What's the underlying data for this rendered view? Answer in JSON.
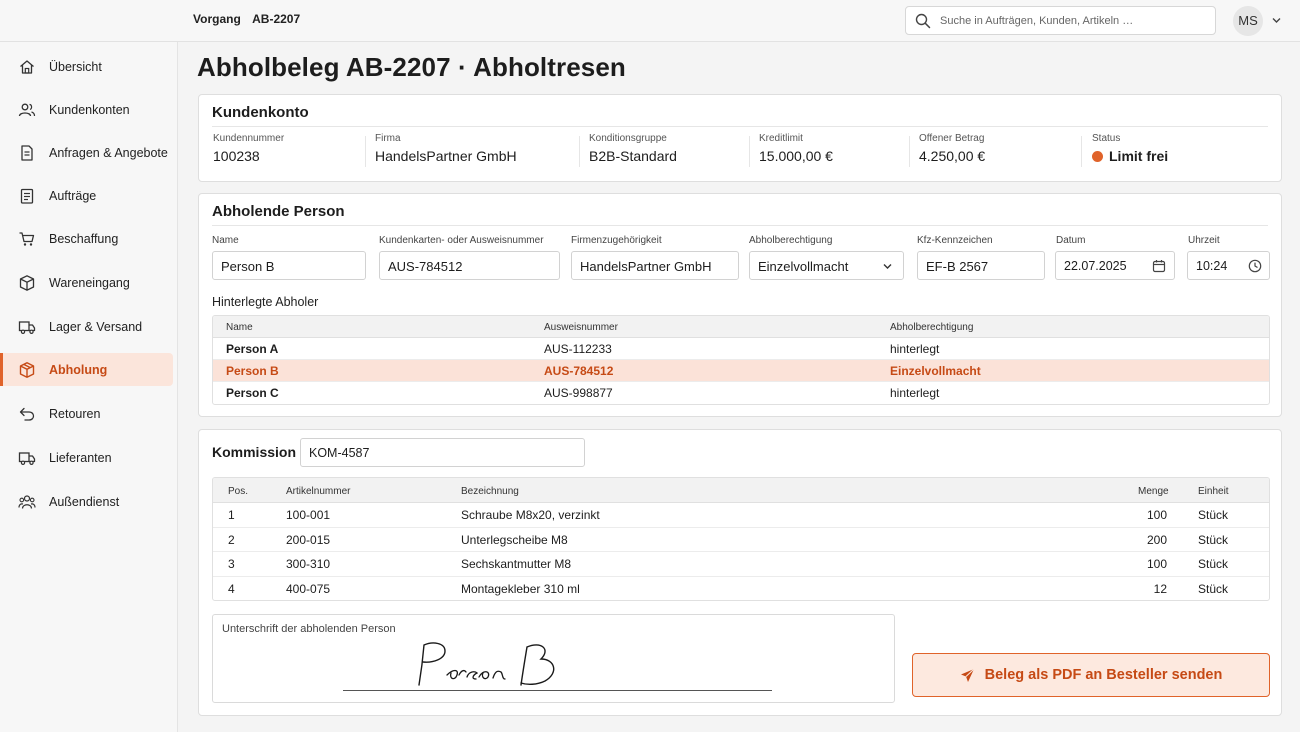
{
  "topbar": {
    "crumb_label": "Vorgang",
    "crumb_value": "AB-2207",
    "search_placeholder": "Suche in Aufträgen, Kunden, Artikeln …",
    "avatar_initials": "MS"
  },
  "sidebar": {
    "items": [
      {
        "label": "Übersicht",
        "icon": "home-icon"
      },
      {
        "label": "Kundenkonten",
        "icon": "users-icon"
      },
      {
        "label": "Anfragen & Angebote",
        "icon": "document-icon"
      },
      {
        "label": "Aufträge",
        "icon": "clipboard-icon"
      },
      {
        "label": "Beschaffung",
        "icon": "cart-icon"
      },
      {
        "label": "Wareneingang",
        "icon": "box-icon"
      },
      {
        "label": "Lager & Versand",
        "icon": "truck-icon"
      },
      {
        "label": "Abholung",
        "icon": "package-icon",
        "active": true
      },
      {
        "label": "Retouren",
        "icon": "return-arrow-icon"
      },
      {
        "label": "Lieferanten",
        "icon": "truck-icon"
      },
      {
        "label": "Außendienst",
        "icon": "team-icon"
      }
    ]
  },
  "page": {
    "title": "Abholbeleg AB-2207 · Abholtresen"
  },
  "kundenkonto": {
    "title": "Kundenkonto",
    "fields": [
      {
        "label": "Kundennummer",
        "value": "100238"
      },
      {
        "label": "Firma",
        "value": "HandelsPartner GmbH"
      },
      {
        "label": "Konditionsgruppe",
        "value": "B2B-Standard"
      },
      {
        "label": "Kreditlimit",
        "value": "15.000,00 €"
      },
      {
        "label": "Offener Betrag",
        "value": "4.250,00 €"
      },
      {
        "label": "Status",
        "value": "Limit frei"
      }
    ],
    "status_color": "#e0632a"
  },
  "abholende_person": {
    "title": "Abholende Person",
    "name_label": "Name",
    "name_value": "Person B",
    "ausweis_label": "Kundenkarten- oder Ausweisnummer",
    "ausweis_value": "AUS-784512",
    "firma_label": "Firmenzugehörigkeit",
    "firma_value": "HandelsPartner GmbH",
    "berechtigung_label": "Abholberechtigung",
    "berechtigung_value": "Einzelvollmacht",
    "kfz_label": "Kfz-Kennzeichen",
    "kfz_value": "EF-B 2567",
    "datum_label": "Datum",
    "datum_value": "22.07.2025",
    "uhrzeit_label": "Uhrzeit",
    "uhrzeit_value": "10:24",
    "hinterlegte_label": "Hinterlegte Abholer",
    "table": {
      "headers": [
        "Name",
        "Ausweisnummer",
        "Abholberechtigung"
      ],
      "rows": [
        {
          "name": "Person A",
          "ausweis": "AUS-112233",
          "berechtigung": "hinterlegt"
        },
        {
          "name": "Person B",
          "ausweis": "AUS-784512",
          "berechtigung": "Einzelvollmacht",
          "selected": true
        },
        {
          "name": "Person C",
          "ausweis": "AUS-998877",
          "berechtigung": "hinterlegt"
        }
      ]
    }
  },
  "kommission": {
    "label": "Kommission",
    "value": "KOM-4587",
    "table": {
      "headers": [
        "Pos.",
        "Artikelnummer",
        "Bezeichnung",
        "Menge",
        "Einheit"
      ],
      "rows": [
        {
          "pos": "1",
          "artikel": "100-001",
          "bezeichnung": "Schraube M8x20, verzinkt",
          "menge": "100",
          "einheit": "Stück"
        },
        {
          "pos": "2",
          "artikel": "200-015",
          "bezeichnung": "Unterlegscheibe M8",
          "menge": "200",
          "einheit": "Stück"
        },
        {
          "pos": "3",
          "artikel": "300-310",
          "bezeichnung": "Sechskantmutter M8",
          "menge": "100",
          "einheit": "Stück"
        },
        {
          "pos": "4",
          "artikel": "400-075",
          "bezeichnung": "Montagekleber 310 ml",
          "menge": "12",
          "einheit": "Stück"
        }
      ]
    },
    "signature_label": "Unterschrift der abholenden Person",
    "signature_text": "Person B",
    "send_button_label": "Beleg als PDF an Besteller senden"
  },
  "colors": {
    "accent": "#e0632a",
    "accent_dark": "#c64a15",
    "accent_light": "#fbe2d8"
  }
}
